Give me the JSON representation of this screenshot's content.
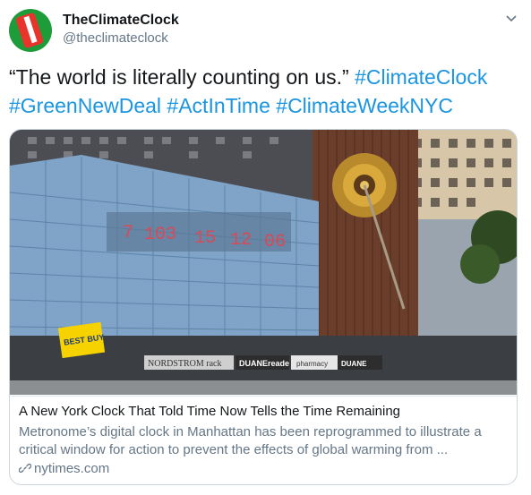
{
  "account": {
    "display_name": "TheClimateClock",
    "handle": "@theclimateclock"
  },
  "tweet": {
    "quote": "“The world is literally counting on us.”",
    "hashtags": [
      "#ClimateClock",
      "#GreenNewDeal",
      "#ActInTime",
      "#ClimateWeekNYC"
    ]
  },
  "card": {
    "clock_digits": [
      "7",
      "103",
      "15",
      "12",
      "06"
    ],
    "signs": {
      "bestbuy": "BEST BUY",
      "nordstrom": "NORDSTROM rack",
      "duanereade": "DUANEreade",
      "pharmacy": "pharmacy",
      "duane2": "DUANE"
    },
    "title": "A New York Clock That Told Time Now Tells the Time Remaining",
    "description": "Metronome’s digital clock in Manhattan has been reprogrammed to illustrate a critical window for action to prevent the effects of global warming from ...",
    "domain": "nytimes.com"
  },
  "icons": {
    "menu": "chevron-down-icon",
    "link": "link-icon"
  },
  "colors": {
    "hashtag": "#1b95e0",
    "secondary_text": "#657786",
    "clock_digits": "#d94a56"
  }
}
